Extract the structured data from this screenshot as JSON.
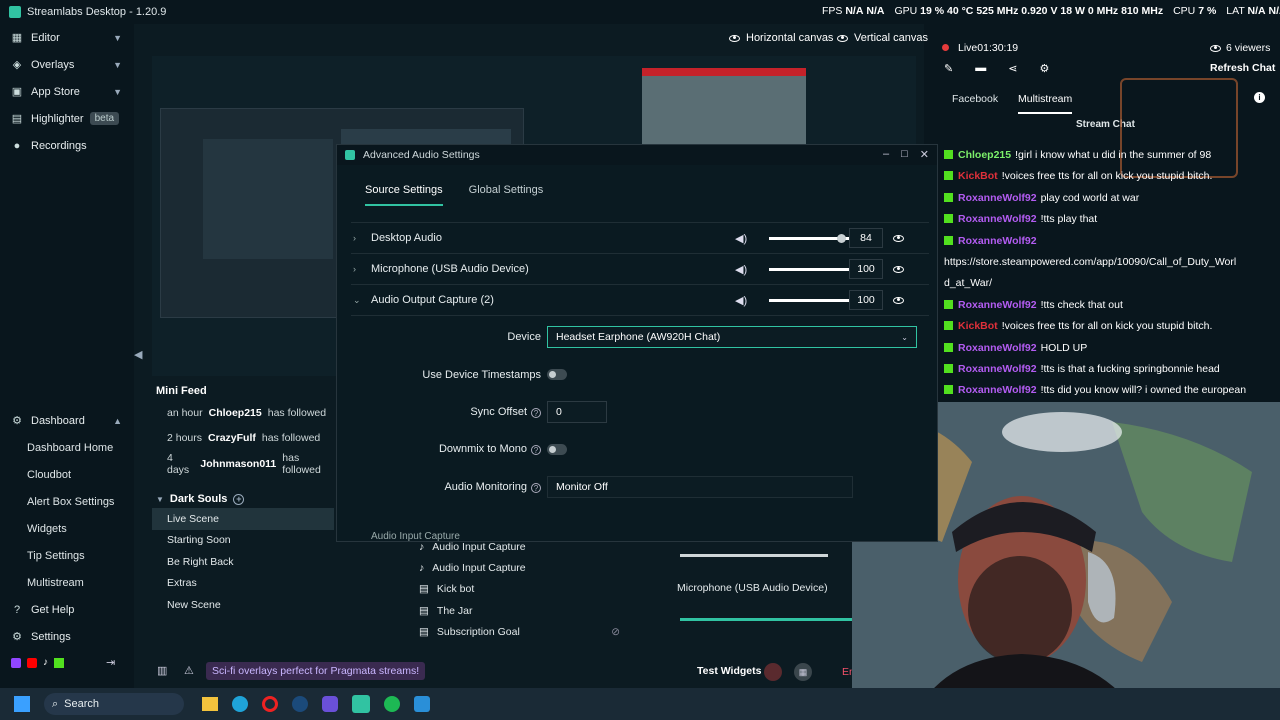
{
  "app": {
    "title": "Streamlabs Desktop - 1.20.9"
  },
  "perf": {
    "fps_label": "FPS",
    "fps_value": "N/A",
    "fps_value2": "N/A",
    "gpu_label": "GPU",
    "gpu_pct": "19 %",
    "gpu_temp": "40 °C",
    "gpu_clock": "525 MHz",
    "gpu_volt": "0.920 V",
    "gpu_watt": "18 W",
    "gpu_mem": "0 MHz",
    "gpu_mem2": "810 MHz",
    "cpu_label": "CPU",
    "cpu_pct": "7 %",
    "lat_label": "LAT",
    "lat_value": "N/A",
    "lat_value2": "N/A"
  },
  "sidebar": {
    "top": [
      {
        "label": "Editor"
      },
      {
        "label": "Overlays"
      },
      {
        "label": "App Store"
      },
      {
        "label": "Highlighter",
        "badge": "beta"
      },
      {
        "label": "Recordings"
      }
    ],
    "dashboard": {
      "label": "Dashboard"
    },
    "dash_items": [
      {
        "label": "Dashboard Home"
      },
      {
        "label": "Cloudbot"
      },
      {
        "label": "Alert Box Settings"
      },
      {
        "label": "Widgets"
      },
      {
        "label": "Tip Settings"
      },
      {
        "label": "Multistream"
      }
    ],
    "help": "Get Help",
    "settings": "Settings"
  },
  "canvas": {
    "horizontal": "Horizontal canvas",
    "vertical": "Vertical canvas"
  },
  "minifeed": {
    "title": "Mini Feed",
    "rows": [
      {
        "time": "an hour",
        "who": "Chloep215",
        "what": "has followed"
      },
      {
        "time": "2 hours",
        "who": "CrazyFulf",
        "what": "has followed"
      },
      {
        "time": "4 days",
        "who": "Johnmason011",
        "what": "has followed"
      }
    ]
  },
  "scenes": {
    "collection": "Dark Souls",
    "items": [
      "Live Scene",
      "Starting Soon",
      "Be Right Back",
      "Extras",
      "New Scene"
    ]
  },
  "sources": {
    "items": [
      "Audio Input Capture",
      "Audio Input Capture",
      "Kick bot",
      "The Jar",
      "Subscription Goal"
    ]
  },
  "mixer": {
    "mic": "Microphone (USB Audio Device)"
  },
  "bottom": {
    "promo": "Sci-fi overlays perfect for Pragmata streams!",
    "test_widgets": "Test Widgets",
    "go_live": "En"
  },
  "dialog": {
    "title": "Advanced Audio Settings",
    "tabs": [
      "Source Settings",
      "Global Settings"
    ],
    "sources": [
      {
        "name": "Desktop Audio",
        "volume": "84",
        "level": 0.84
      },
      {
        "name": "Microphone (USB Audio Device)",
        "volume": "100",
        "level": 1.0
      },
      {
        "name": "Audio Output Capture (2)",
        "volume": "100",
        "level": 1.0
      }
    ],
    "device_label": "Device",
    "device_value": "Headset Earphone (AW920H Chat)",
    "timestamps_label": "Use Device Timestamps",
    "sync_label": "Sync Offset",
    "sync_value": "0",
    "downmix_label": "Downmix to Mono",
    "monitoring_label": "Audio Monitoring",
    "monitoring_value": "Monitor Off",
    "next_row": "Audio Input Capture"
  },
  "chat": {
    "live": "Live",
    "uptime": "01:30:19",
    "viewers": "6 viewers",
    "refresh": "Refresh Chat",
    "tabs": [
      "Facebook",
      "Multistream"
    ],
    "stream_chat": "Stream Chat",
    "messages": [
      {
        "name": "Chloep215",
        "color": "#7cf06a",
        "text": "!girl i know what u did in the summer of 98"
      },
      {
        "name": "KickBot",
        "color": "#e0303a",
        "text": "!voices free tts for all on kick you stupid bitch."
      },
      {
        "name": "RoxanneWolf92",
        "color": "#b35cf2",
        "text": "play cod world at war"
      },
      {
        "name": "RoxanneWolf92",
        "color": "#b35cf2",
        "text": "!tts play that"
      },
      {
        "name": "RoxanneWolf92",
        "color": "#b35cf2",
        "text": ""
      },
      {
        "name": "",
        "color": "#ffffff",
        "text": "https://store.steampowered.com/app/10090/Call_of_Duty_Worl"
      },
      {
        "name": "",
        "color": "#ffffff",
        "text": "d_at_War/"
      },
      {
        "name": "RoxanneWolf92",
        "color": "#b35cf2",
        "text": "!tts check that out"
      },
      {
        "name": "KickBot",
        "color": "#e0303a",
        "text": "!voices free tts for all on kick you stupid bitch."
      },
      {
        "name": "RoxanneWolf92",
        "color": "#b35cf2",
        "text": "HOLD UP"
      },
      {
        "name": "RoxanneWolf92",
        "color": "#b35cf2",
        "text": "!tts is that a fucking springbonnie head"
      },
      {
        "name": "RoxanneWolf92",
        "color": "#b35cf2",
        "text": "!tts did you know will? i owned the european"
      }
    ]
  },
  "taskbar": {
    "search": "Search"
  },
  "colors": {
    "accent": "#31c3a2",
    "bg": "#09161d",
    "kick": "#52e01f"
  }
}
